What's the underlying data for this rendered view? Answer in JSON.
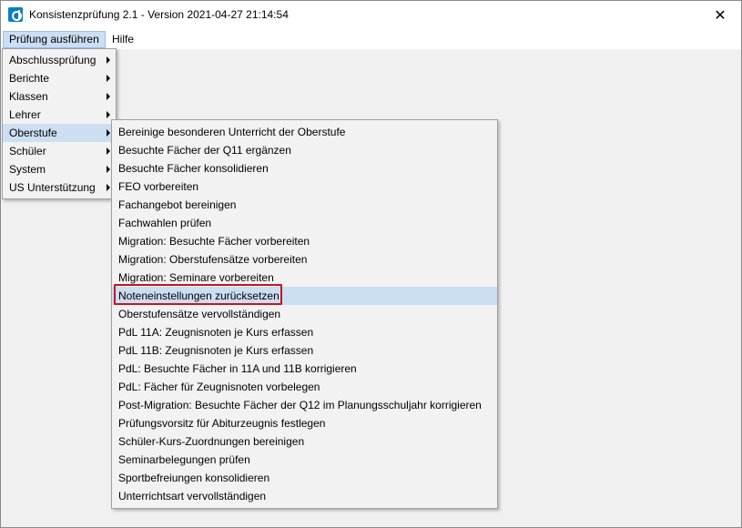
{
  "window": {
    "title": "Konsistenzprüfung 2.1 - Version 2021-04-27 21:14:54",
    "close_glyph": "✕"
  },
  "menubar": {
    "items": [
      {
        "label": "Prüfung ausführen"
      },
      {
        "label": "Hilfe"
      }
    ]
  },
  "main_menu": {
    "items": [
      {
        "label": "Abschlussprüfung"
      },
      {
        "label": "Berichte"
      },
      {
        "label": "Klassen"
      },
      {
        "label": "Lehrer"
      },
      {
        "label": "Oberstufe"
      },
      {
        "label": "Schüler"
      },
      {
        "label": "System"
      },
      {
        "label": "US Unterstützung"
      }
    ]
  },
  "submenu_oberstufe": {
    "items": [
      {
        "label": "Bereinige besonderen Unterricht der Oberstufe"
      },
      {
        "label": "Besuchte Fächer der Q11 ergänzen"
      },
      {
        "label": "Besuchte Fächer konsolidieren"
      },
      {
        "label": "FEO vorbereiten"
      },
      {
        "label": "Fachangebot bereinigen"
      },
      {
        "label": "Fachwahlen prüfen"
      },
      {
        "label": "Migration: Besuchte Fächer vorbereiten"
      },
      {
        "label": "Migration: Oberstufensätze vorbereiten"
      },
      {
        "label": "Migration: Seminare vorbereiten"
      },
      {
        "label": "Noteneinstellungen zurücksetzen"
      },
      {
        "label": "Oberstufensätze vervollständigen"
      },
      {
        "label": "PdL 11A: Zeugnisnoten je Kurs erfassen"
      },
      {
        "label": "PdL 11B: Zeugnisnoten je Kurs erfassen"
      },
      {
        "label": "PdL: Besuchte Fächer in 11A und 11B korrigieren"
      },
      {
        "label": "PdL: Fächer für Zeugnisnoten vorbelegen"
      },
      {
        "label": "Post-Migration: Besuchte Fächer der Q12 im Planungsschuljahr korrigieren"
      },
      {
        "label": "Prüfungsvorsitz für Abiturzeugnis festlegen"
      },
      {
        "label": "Schüler-Kurs-Zuordnungen bereinigen"
      },
      {
        "label": "Seminarbelegungen prüfen"
      },
      {
        "label": "Sportbefreiungen konsolidieren"
      },
      {
        "label": "Unterrichtsart vervollständigen"
      }
    ]
  },
  "colors": {
    "highlight": "#ccdef2",
    "annotation": "#c0181f",
    "app_icon": "#0a7fc1"
  },
  "icons": {
    "app": "app-logo-icon",
    "close": "close-icon",
    "submenu": "submenu-arrow-icon"
  }
}
